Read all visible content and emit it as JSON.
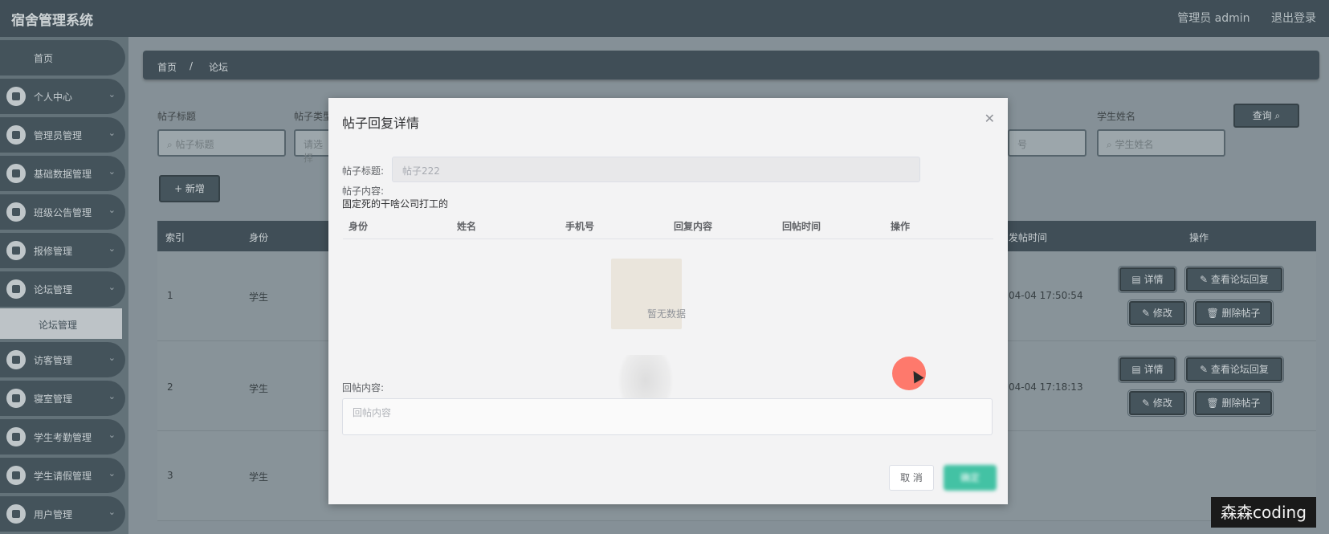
{
  "app": {
    "title": "宿舍管理系统",
    "user": "管理员 admin",
    "logout": "退出登录"
  },
  "sidebar": {
    "home": "首页",
    "items": [
      {
        "label": "个人中心"
      },
      {
        "label": "管理员管理"
      },
      {
        "label": "基础数据管理"
      },
      {
        "label": "班级公告管理"
      },
      {
        "label": "报修管理"
      },
      {
        "label": "论坛管理"
      },
      {
        "label": "访客管理"
      },
      {
        "label": "寝室管理"
      },
      {
        "label": "学生考勤管理"
      },
      {
        "label": "学生请假管理"
      },
      {
        "label": "用户管理"
      }
    ],
    "active_sub": "论坛管理"
  },
  "breadcrumb": {
    "home": "首页",
    "sep": "/",
    "current": "论坛"
  },
  "filters": {
    "title_label": "帖子标题",
    "title_placeholder": "帖子标题",
    "type_label": "帖子类型",
    "type_placeholder": "请选择",
    "student_label": "学生姓名",
    "student_placeholder": "学生姓名",
    "other_placeholder": "号",
    "search_btn": "查询"
  },
  "toolbar": {
    "add_btn": "+ 新增"
  },
  "table": {
    "headers": {
      "index": "索引",
      "identity": "身份",
      "post_time": "发帖时间",
      "actions": "操作"
    },
    "rows": [
      {
        "index": "1",
        "identity": "学生",
        "time": "04-04 17:50:54"
      },
      {
        "index": "2",
        "identity": "学生",
        "time": "04-04 17:18:13"
      },
      {
        "index": "3",
        "identity": "学生",
        "time": ""
      }
    ],
    "row_buttons": {
      "detail": "详情",
      "view_replies": "查看论坛回复",
      "edit": "修改",
      "delete": "删除帖子"
    }
  },
  "modal": {
    "title": "帖子回复详情",
    "post_title_label": "帖子标题:",
    "post_title_value": "帖子222",
    "post_content_label": "帖子内容:",
    "post_content_value": "固定死的干啥公司打工的",
    "reply_headers": [
      "身份",
      "姓名",
      "手机号",
      "回复内容",
      "回帖时间",
      "操作"
    ],
    "empty_text": "暂无数据",
    "reply_label": "回帖内容:",
    "reply_placeholder": "回帖内容",
    "cancel": "取 消",
    "confirm": "确定"
  },
  "watermark": "森森coding"
}
